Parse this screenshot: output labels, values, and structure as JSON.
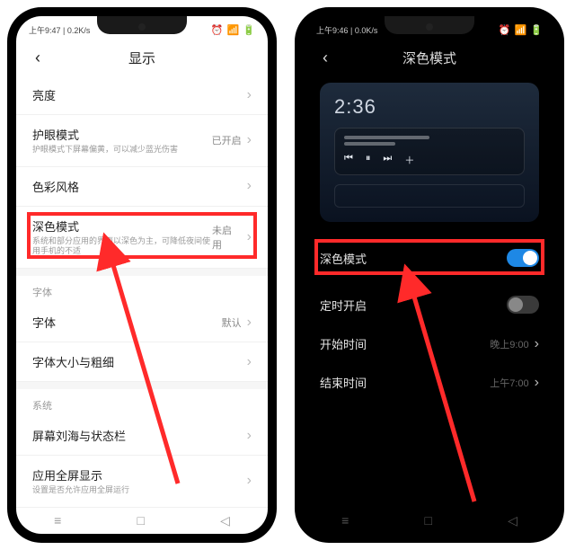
{
  "left": {
    "statusbar": {
      "left": "上午9:47 | 0.2K/s",
      "alarm": "⏰",
      "wifi": "📶",
      "batt": "🔋"
    },
    "header": {
      "title": "显示"
    },
    "rows": {
      "brightness": {
        "title": "亮度"
      },
      "eyecare": {
        "title": "护眼模式",
        "sub": "护眼模式下屏幕偏黄，可以减少蓝光伤害",
        "value": "已开启"
      },
      "color": {
        "title": "色彩风格"
      },
      "dark": {
        "title": "深色模式",
        "sub": "系统和部分应用的界面以深色为主，可降低夜间使用手机的不适",
        "value": "未启用"
      },
      "font_label": "字体",
      "font": {
        "title": "字体",
        "value": "默认"
      },
      "fontsize": {
        "title": "字体大小与粗细"
      },
      "sys_label": "系统",
      "notchbar": {
        "title": "屏幕刘海与状态栏"
      },
      "fullscreen": {
        "title": "应用全屏显示",
        "sub": "设置是否允许应用全屏运行"
      }
    }
  },
  "right": {
    "statusbar": {
      "left": "上午9:46 | 0.0K/s",
      "alarm": "⏰",
      "wifi": "📶",
      "batt": "🔋"
    },
    "header": {
      "title": "深色模式"
    },
    "preview": {
      "time": "2:36"
    },
    "rows": {
      "darkmode": {
        "title": "深色模式",
        "on": true
      },
      "schedule": {
        "title": "定时开启",
        "on": false
      },
      "start": {
        "title": "开始时间",
        "value": "晚上9:00"
      },
      "end": {
        "title": "结束时间",
        "value": "上午7:00"
      }
    }
  }
}
